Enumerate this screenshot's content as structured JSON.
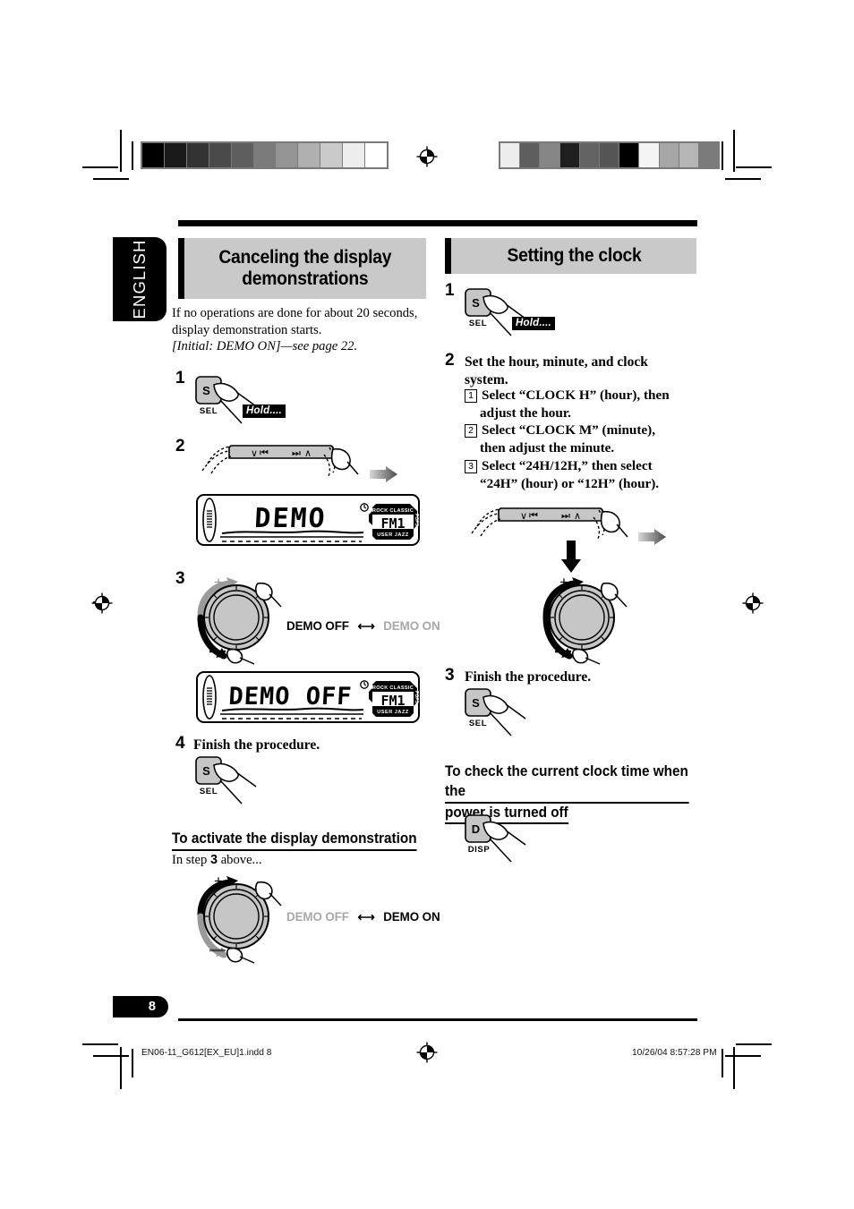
{
  "page": {
    "language_tab": "ENGLISH",
    "page_number": "8"
  },
  "footer": {
    "file_name": "EN06-11_G612[EX_EU]1.indd   8",
    "timestamp": "10/26/04   8:57:28 PM"
  },
  "left_column": {
    "heading_line1": "Canceling the display",
    "heading_line2": "demonstrations",
    "intro_line1": "If no operations are done for about 20 seconds,",
    "intro_line2": "display demonstration starts.",
    "intro_line3": "[Initial: DEMO ON]—see page 22.",
    "step1": {
      "number": "1",
      "button_letter": "S",
      "button_label": "SEL",
      "hold_tag": "Hold...."
    },
    "step2": {
      "number": "2",
      "strip_left_symbol": "∨|◀◀",
      "strip_right_symbol": "▶▶|∧",
      "lcd_text": "DEMO",
      "lcd_band": "FM1",
      "lcd_eq_labels": [
        "ROCK",
        "CLASSIC",
        "POPS",
        "USER",
        "JAZZ"
      ]
    },
    "step3": {
      "number": "3",
      "knob_plus": "+",
      "knob_minus": "–",
      "label_left": "DEMO OFF",
      "label_arrow": "←→",
      "label_right": "DEMO ON",
      "active_side": "left",
      "lcd_text": "DEMO OFF",
      "lcd_band": "FM1"
    },
    "step4": {
      "number": "4",
      "text": "Finish the procedure.",
      "button_letter": "S",
      "button_label": "SEL"
    },
    "activate_section": {
      "heading": "To activate the display demonstration",
      "note_prefix": "In step ",
      "note_step": "3",
      "note_suffix": " above...",
      "knob_plus": "+",
      "knob_minus": "–",
      "label_left": "DEMO OFF",
      "label_arrow": "←→",
      "label_right": "DEMO ON",
      "active_side": "right"
    }
  },
  "right_column": {
    "heading": "Setting the clock",
    "step1": {
      "number": "1",
      "button_letter": "S",
      "button_label": "SEL",
      "hold_tag": "Hold...."
    },
    "step2": {
      "number": "2",
      "text_line1": "Set the hour, minute, and clock",
      "text_line2": "system.",
      "substeps": [
        {
          "marker": "1",
          "line1": "Select “CLOCK H” (hour), then",
          "line2": "adjust the hour."
        },
        {
          "marker": "2",
          "line1": "Select “CLOCK M” (minute),",
          "line2": "then adjust the minute."
        },
        {
          "marker": "3",
          "line1": "Select “24H/12H,” then select",
          "line2": "“24H” (hour) or “12H” (hour)."
        }
      ],
      "strip_left_symbol": "∨|◀◀",
      "strip_right_symbol": "▶▶|∧",
      "knob_plus": "+",
      "knob_minus": "–"
    },
    "step3": {
      "number": "3",
      "text": "Finish the procedure.",
      "button_letter": "S",
      "button_label": "SEL"
    },
    "check_section": {
      "heading_line1": "To check the current clock time when the",
      "heading_line2": "power is turned off",
      "button_letter": "D",
      "button_label": "DISP"
    }
  },
  "print_marks": {
    "calibration_left": [
      "#000000",
      "#1a1a1a",
      "#333333",
      "#4a4a4a",
      "#5e5e5e",
      "#7b7b7b",
      "#949494",
      "#b0b0b0",
      "#cacaca",
      "#ededed",
      "#ffffff"
    ],
    "calibration_right": [
      "#ededed",
      "#5e5e5e",
      "#858585",
      "#1f1f1f",
      "#636363",
      "#565656",
      "#000000",
      "#f4f4f4",
      "#a6a6a6",
      "#b5b5b5",
      "#7b7b7b"
    ],
    "registration_icon": "registration-target"
  }
}
